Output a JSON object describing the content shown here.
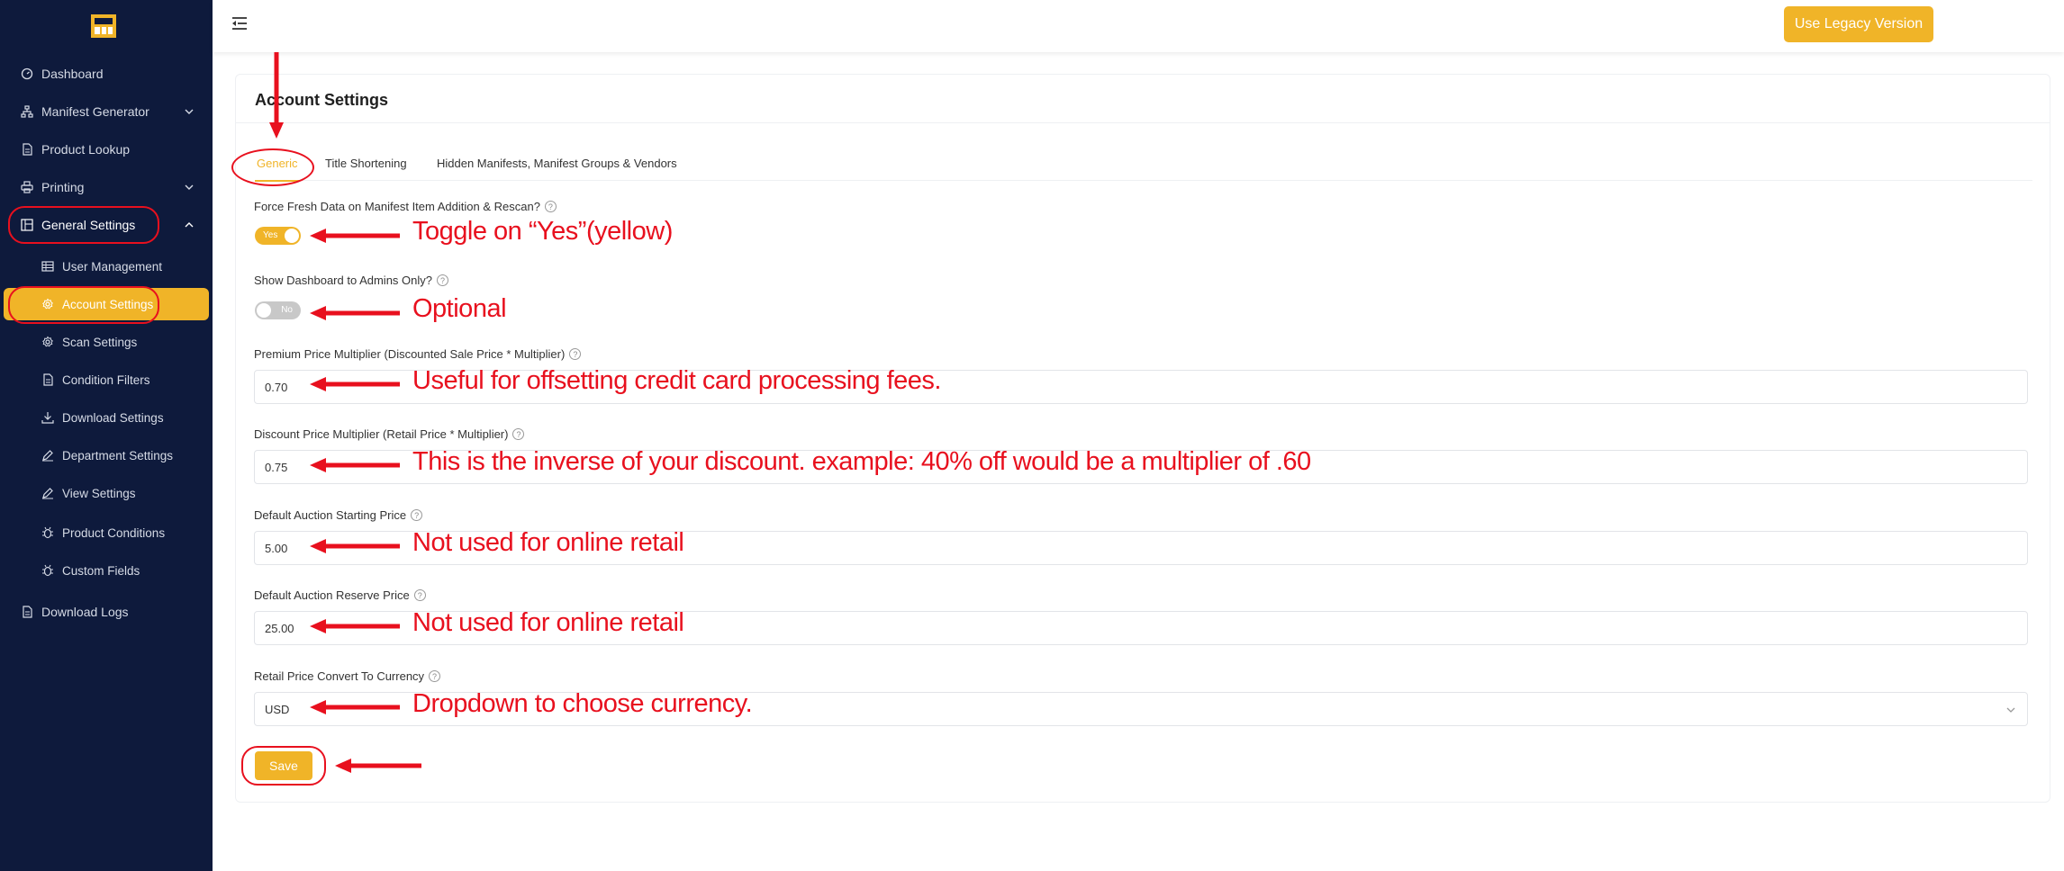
{
  "sidebar": {
    "items": [
      {
        "label": "Dashboard"
      },
      {
        "label": "Manifest Generator"
      },
      {
        "label": "Product Lookup"
      },
      {
        "label": "Printing"
      },
      {
        "label": "General Settings"
      },
      {
        "label": "User Management"
      },
      {
        "label": "Account Settings"
      },
      {
        "label": "Scan Settings"
      },
      {
        "label": "Condition Filters"
      },
      {
        "label": "Download Settings"
      },
      {
        "label": "Department Settings"
      },
      {
        "label": "View Settings"
      },
      {
        "label": "Product Conditions"
      },
      {
        "label": "Custom Fields"
      },
      {
        "label": "Download Logs"
      }
    ]
  },
  "topbar": {
    "legacy_button": "Use Legacy Version"
  },
  "page": {
    "title": "Account Settings",
    "tabs": [
      "Generic",
      "Title Shortening",
      "Hidden Manifests, Manifest Groups & Vendors"
    ],
    "fields": {
      "force_fresh": {
        "label": "Force Fresh Data on Manifest Item Addition & Rescan?",
        "toggle_text": "Yes",
        "state": "on"
      },
      "show_dashboard": {
        "label": "Show Dashboard to Admins Only?",
        "toggle_text": "No",
        "state": "off"
      },
      "premium_multiplier": {
        "label": "Premium Price Multiplier (Discounted Sale Price * Multiplier)",
        "value": "0.70"
      },
      "discount_multiplier": {
        "label": "Discount Price Multiplier (Retail Price * Multiplier)",
        "value": "0.75"
      },
      "auction_start": {
        "label": "Default Auction Starting Price",
        "value": "5.00"
      },
      "auction_reserve": {
        "label": "Default Auction Reserve Price",
        "value": "25.00"
      },
      "currency": {
        "label": "Retail Price Convert To Currency",
        "value": "USD"
      }
    },
    "save_button": "Save"
  },
  "annotations": {
    "force_fresh": "Toggle on “Yes”(yellow)",
    "show_dashboard": "Optional",
    "premium": "Useful for offsetting credit card processing fees.",
    "discount": "This is the inverse of your discount. example: 40% off would be a multiplier of .60",
    "auction_start": "Not used for online retail",
    "auction_reserve": "Not used for online retail",
    "currency": "Dropdown to choose currency."
  },
  "colors": {
    "accent": "#f0b428",
    "sidebar": "#0e1a3c",
    "annotation": "#e8101e"
  }
}
